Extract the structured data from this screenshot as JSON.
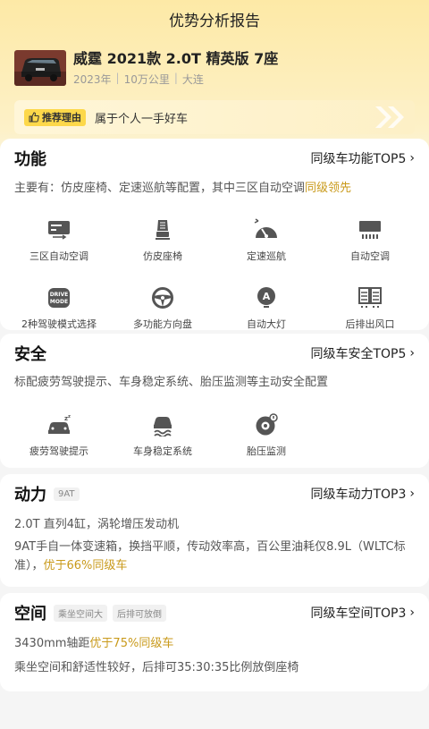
{
  "header": {
    "title": "优势分析报告"
  },
  "car": {
    "title": "威霆 2021款 2.0T 精英版 7座",
    "year": "2023年",
    "mileage": "10万公里",
    "city": "大连"
  },
  "reason": {
    "badge": "推荐理由",
    "text": "属于个人一手好车"
  },
  "function": {
    "title": "功能",
    "link": "同级车功能TOP5",
    "desc_prefix": "主要有：仿皮座椅、定速巡航等配置，其中三区自动空调",
    "desc_highlight": "同级领先",
    "items": [
      {
        "label": "三区自动空调",
        "icon": "climate-panel-icon"
      },
      {
        "label": "仿皮座椅",
        "icon": "seat-icon"
      },
      {
        "label": "定速巡航",
        "icon": "speedometer-icon"
      },
      {
        "label": "自动空调",
        "icon": "ac-unit-icon"
      },
      {
        "label": "2种驾驶模式选择",
        "icon": "drive-mode-icon"
      },
      {
        "label": "多功能方向盘",
        "icon": "steering-wheel-icon"
      },
      {
        "label": "自动大灯",
        "icon": "auto-headlight-icon"
      },
      {
        "label": "后排出风口",
        "icon": "rear-vent-icon"
      }
    ]
  },
  "safety": {
    "title": "安全",
    "link": "同级车安全TOP5",
    "desc": "标配疲劳驾驶提示、车身稳定系统、胎压监测等主动安全配置",
    "items": [
      {
        "label": "疲劳驾驶提示",
        "icon": "fatigue-alert-icon"
      },
      {
        "label": "车身稳定系统",
        "icon": "stability-control-icon"
      },
      {
        "label": "胎压监测",
        "icon": "tire-pressure-icon"
      }
    ]
  },
  "power": {
    "title": "动力",
    "tag": "9AT",
    "link": "同级车动力TOP3",
    "line1": "2.0T 直列4缸，涡轮增压发动机",
    "line2_prefix": "9AT手自一体变速箱，换挡平顺，传动效率高，百公里油耗仅8.9L（WLTC标准），",
    "line2_highlight": "优于66%同级车"
  },
  "space": {
    "title": "空间",
    "tags": [
      "乘坐空间大",
      "后排可放倒"
    ],
    "link": "同级车空间TOP3",
    "line1_prefix": "3430mm轴距",
    "line1_highlight": "优于75%同级车",
    "line2": "乘坐空间和舒适性较好，后排可35:30:35比例放倒座椅"
  },
  "colors": {
    "highlight": "#c99a1b",
    "badge": "#fdd84a",
    "header_bg": "#fde9a6"
  }
}
